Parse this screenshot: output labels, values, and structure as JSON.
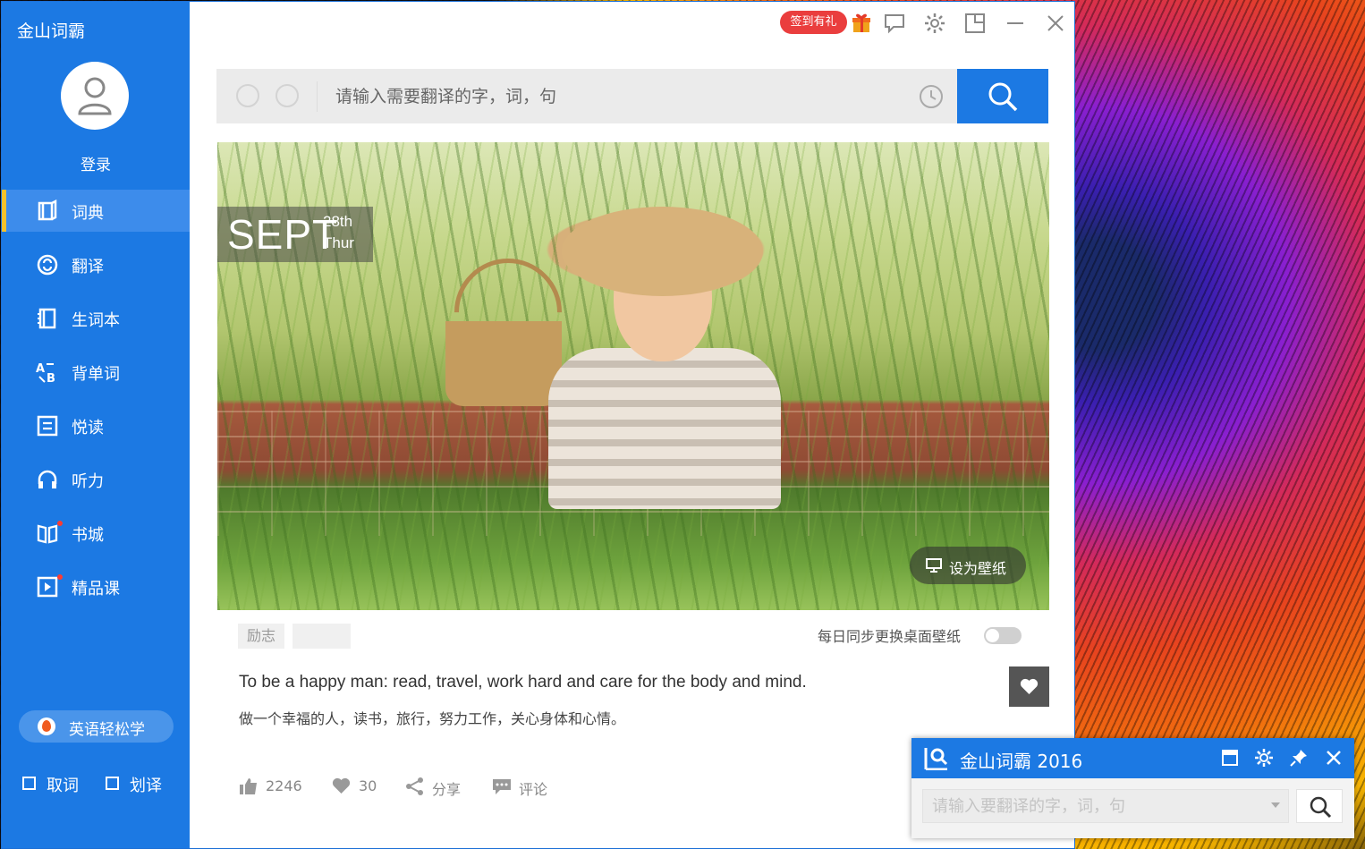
{
  "app": {
    "title": "金山词霸"
  },
  "sidebar": {
    "login_label": "登录",
    "items": [
      {
        "label": "词典",
        "icon": "dictionary-icon",
        "active": true
      },
      {
        "label": "翻译",
        "icon": "translate-icon",
        "active": false
      },
      {
        "label": "生词本",
        "icon": "wordbook-icon",
        "active": false
      },
      {
        "label": "背单词",
        "icon": "memorize-icon",
        "active": false
      },
      {
        "label": "悦读",
        "icon": "reading-icon",
        "active": false
      },
      {
        "label": "听力",
        "icon": "headphones-icon",
        "active": false
      },
      {
        "label": "书城",
        "icon": "bookstore-icon",
        "active": false
      },
      {
        "label": "精品课",
        "icon": "course-icon",
        "active": false
      }
    ],
    "promo_label": "英语轻松学",
    "checkboxes": [
      {
        "label": "取词",
        "checked": false
      },
      {
        "label": "划译",
        "checked": false
      }
    ]
  },
  "titlebar": {
    "checkin_label": "签到有礼"
  },
  "search": {
    "placeholder": "请输入需要翻译的字，词，句"
  },
  "daily": {
    "month": "SEPT",
    "day": "28th",
    "weekday": "Thur",
    "set_wallpaper_label": "设为壁纸",
    "tags": [
      "励志",
      ""
    ],
    "sync_label": "每日同步更换桌面壁纸",
    "sync_enabled": false,
    "quote_en": "To be a happy man: read, travel, work hard and care for the body and mind.",
    "quote_cn": "做一个幸福的人，读书，旅行，努力工作，关心身体和心情。",
    "likes": "2246",
    "favorites": "30",
    "share_label": "分享",
    "comment_label": "评论"
  },
  "mini_window": {
    "title": "金山词霸 2016",
    "placeholder": "请输入要翻译的字，词，句"
  },
  "colors": {
    "brand_blue": "#1c79e3",
    "active_indicator": "#f6c22b",
    "checkin_red": "#ea3e3e"
  }
}
